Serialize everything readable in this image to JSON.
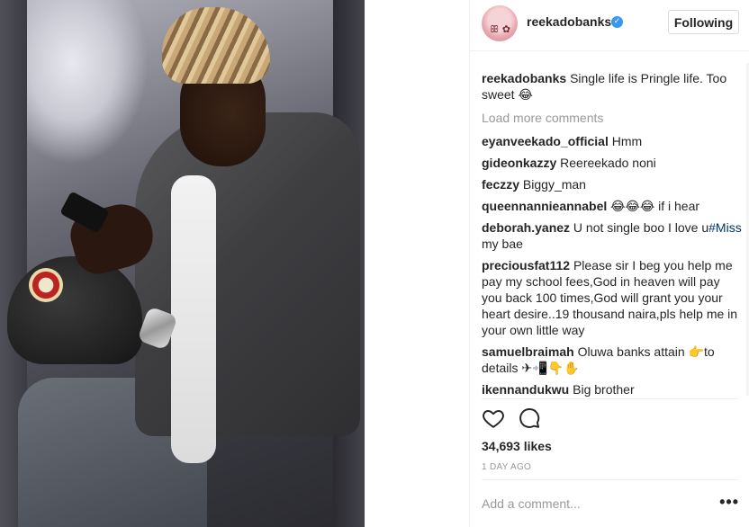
{
  "post": {
    "author": "reekadobanks",
    "verified_icon": "verified-badge-icon",
    "follow_label": "Following",
    "avatar_icon": "profile-avatar"
  },
  "comments": {
    "caption": {
      "user": "reekadobanks",
      "text": "Single life is Pringle life. Too sweet 😂"
    },
    "load_more": "Load more comments",
    "items": [
      {
        "user": "eyanveekado_official",
        "text": "Hmm"
      },
      {
        "user": "gideonkazzy",
        "text": "Reereekado noni"
      },
      {
        "user": "feczzy",
        "text": "Biggy_man"
      },
      {
        "user": "queennannieannabel",
        "text": "😂😂😂 if i hear"
      },
      {
        "user": "deborah.yanez",
        "text": "U not single boo I love u",
        "hashtag": "#Miss",
        "after": " my bae"
      },
      {
        "user": "preciousfat112",
        "text": "Please sir I beg you help me pay my school fees,God in heaven will pay you back 100 times,God will grant you your heart desire..19 thousand naira,pls help me in your own little way"
      },
      {
        "user": "samuelbraimah",
        "text": "Oluwa banks attain 👉to details ✈📲👇✋"
      },
      {
        "user": "ikennandukwu",
        "text": "Big brother"
      }
    ]
  },
  "actions": {
    "like_icon": "heart-icon",
    "comment_icon": "comment-icon",
    "likes": "34,693 likes",
    "time": "1 DAY AGO"
  },
  "composer": {
    "placeholder": "Add a comment...",
    "more_icon": "more-options-icon",
    "more_label": "•••"
  }
}
